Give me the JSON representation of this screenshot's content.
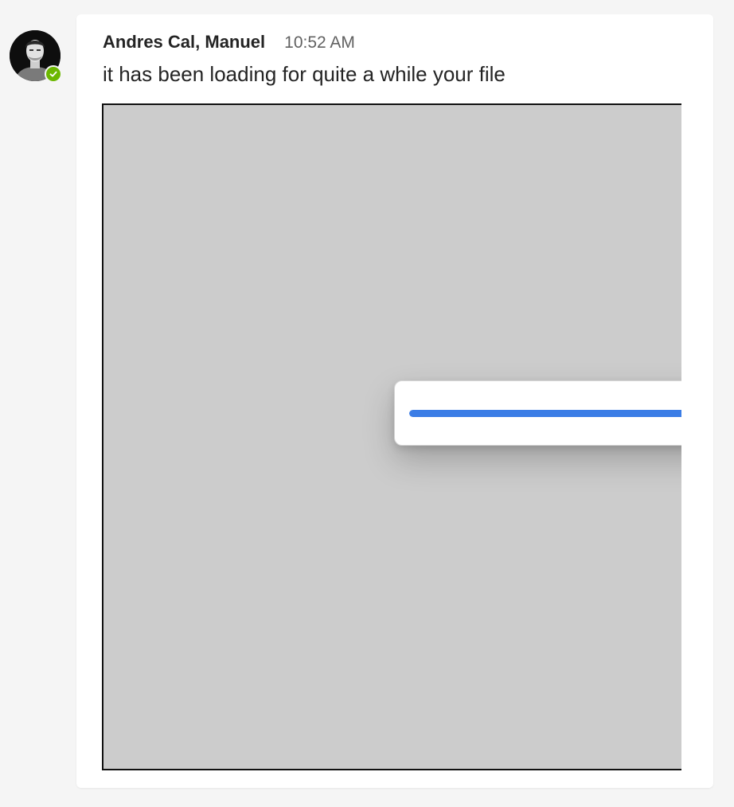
{
  "message": {
    "sender": "Andres Cal, Manuel",
    "time": "10:52 AM",
    "text": "it has been loading for quite a while your file",
    "presence": "available",
    "avatar_icon": "user-photo",
    "presence_icon": "checkmark-icon"
  },
  "attachment": {
    "progress": 1.0
  },
  "colors": {
    "presence_available": "#6bb700",
    "progress_fill": "#3b7de6",
    "attachment_background": "#cccccc",
    "card_background": "#ffffff",
    "page_background": "#f5f5f5"
  }
}
